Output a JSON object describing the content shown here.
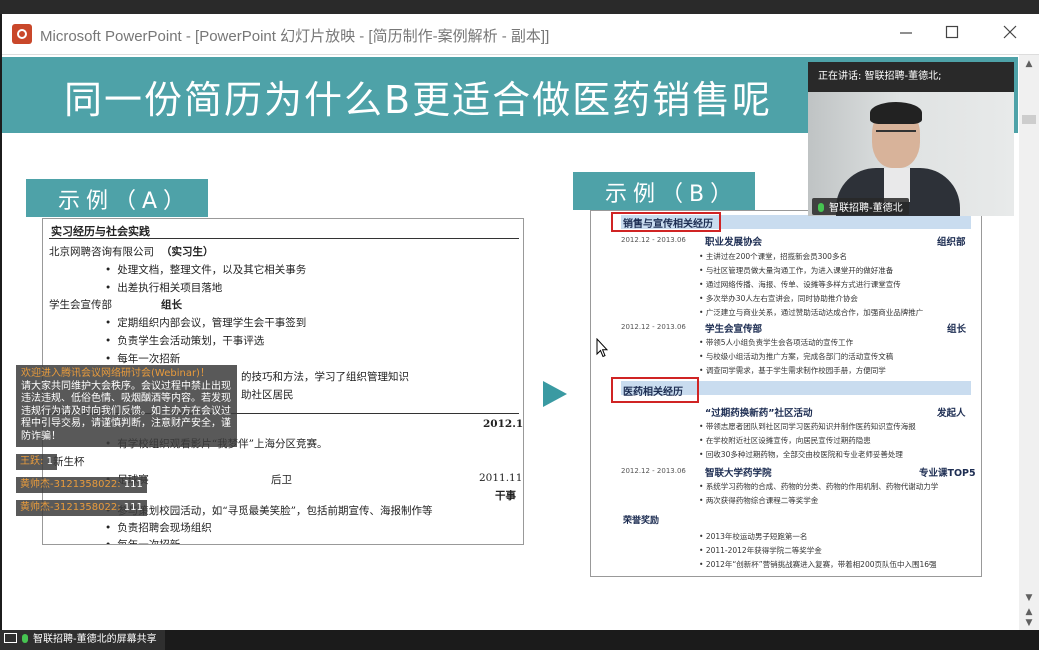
{
  "window": {
    "title": "Microsoft PowerPoint - [PowerPoint 幻灯片放映 - [简历制作-案例解析 - 副本]]"
  },
  "slide": {
    "title": "同一份简历为什么B更适合做医药销售呢",
    "example_a_label": "示例（A）",
    "example_b_label": "示例（B）",
    "resume_a": {
      "section_heading": "实习经历与社会实践",
      "lines": [
        {
          "text": "北京网聘咨询有限公司",
          "bullet": false
        },
        {
          "text": "（实习生）",
          "bullet": false,
          "bold": true
        },
        {
          "text": "处理文档，整理文件，以及其它相关事务",
          "bullet": true
        },
        {
          "text": "出差执行相关项目落地",
          "bullet": true
        },
        {
          "text": "学生会宣传部",
          "bullet": false
        },
        {
          "text": "组长",
          "bullet": false,
          "bold": true
        },
        {
          "text": "定期组织内部会议，管理学生会干事签到",
          "bullet": true
        },
        {
          "text": "负责学生会活动策划，干事评选",
          "bullet": true
        },
        {
          "text": "每年一次招新",
          "bullet": true
        },
        {
          "text": "的技巧和方法，学习了组织管理知识",
          "bullet": false
        },
        {
          "text": "助社区居民",
          "bullet": false
        },
        {
          "text": "2012.10",
          "bullet": false,
          "bold": true
        },
        {
          "text": "有学校组织观看影片“我梦伴”上海分区竞赛。",
          "bullet": true
        },
        {
          "text": "新生杯",
          "bullet": false
        },
        {
          "text": "足球赛",
          "bullet": true
        },
        {
          "text": "后卫",
          "bullet": false
        },
        {
          "text": "2011.11",
          "bullet": false
        },
        {
          "text": "干事",
          "bullet": false,
          "bold": true
        },
        {
          "text": "参与策划校园活动，如“寻觅最美笑脸”，包括前期宣传、海报制作等",
          "bullet": true
        },
        {
          "text": "负责招聘会现场组织",
          "bullet": true
        },
        {
          "text": "每年一次招新",
          "bullet": true
        }
      ]
    },
    "resume_b": {
      "section1": "销售与宣传相关经历",
      "section2": "医药相关经历",
      "section3": "荣誉奖励",
      "entries": [
        {
          "date": "2012.12 - 2013.06",
          "title": "职业发展协会",
          "role": "组织部"
        },
        {
          "date": "2012.12 - 2013.06",
          "title": "学生会宣传部",
          "role": "组长"
        },
        {
          "date": "",
          "title": "“过期药换新药”社区活动",
          "role": "发起人"
        },
        {
          "date": "2012.12 - 2013.06",
          "title": "智联大学药学院",
          "role": "专业课TOP5"
        }
      ],
      "bullets1": [
        "主讲过在200个课堂，招揽新会员300多名",
        "与社区管理员做大量沟通工作，为进入课堂开的做好准备",
        "通过网络传播、海报、传单、设摊等多样方式进行课堂宣传",
        "多次举办30人左右宣讲会，同时协助推介协会",
        "广泛建立与商业关系，通过赞助活动达成合作，加强商业品牌推广"
      ],
      "bullets2": [
        "带领5人小组负责学生会各项活动的宣传工作",
        "与校级小组活动为推广方案，完成各部门的活动宣传文稿",
        "调查同学需求，基于学生需求制作校园手册，方便同学"
      ],
      "bullets3": [
        "带领志愿者团队到社区同学习医药知识并制作医药知识宣传海报",
        "在学校附近社区设摊宣传，向居民宣传过期药隐患",
        "回收30多种过期药物，全部交由校医院和专业老师妥善处理"
      ],
      "bullets4": [
        "系统学习药物的合成、药物的分类、药物的作用机制、药物代谢动力学",
        "两次获得药物综合课程二等奖学金"
      ],
      "honors": [
        "2013年校运动男子短跑第一名",
        "2011-2012年获得学院二等奖学金",
        "2012年“创新杯”营销挑战赛进入复赛，带着相200页队伍中入围16强"
      ]
    }
  },
  "meeting": {
    "speaking_label": "正在讲话: 智联招聘-董德北;",
    "video_name": "智联招聘-董德北",
    "share_label": "智联招聘-董德北的屏幕共享",
    "notice_head": "欢迎进入腾讯会议网络研讨会(Webinar)！",
    "notice_body": "请大家共同维护大会秩序。会议过程中禁止出现违法违规、低俗色情、吸烟酗酒等内容。若发现违规行为请及时向我们反馈。如主办方在会议过程中引导交易，请谨慎判断，注意财产安全，谨防诈骗！",
    "chat": [
      {
        "user": "王跃:",
        "msg": "1"
      },
      {
        "user": "黄帅杰-3121358022:",
        "msg": "111"
      },
      {
        "user": "黄帅杰-3121358022:",
        "msg": "111"
      }
    ]
  }
}
